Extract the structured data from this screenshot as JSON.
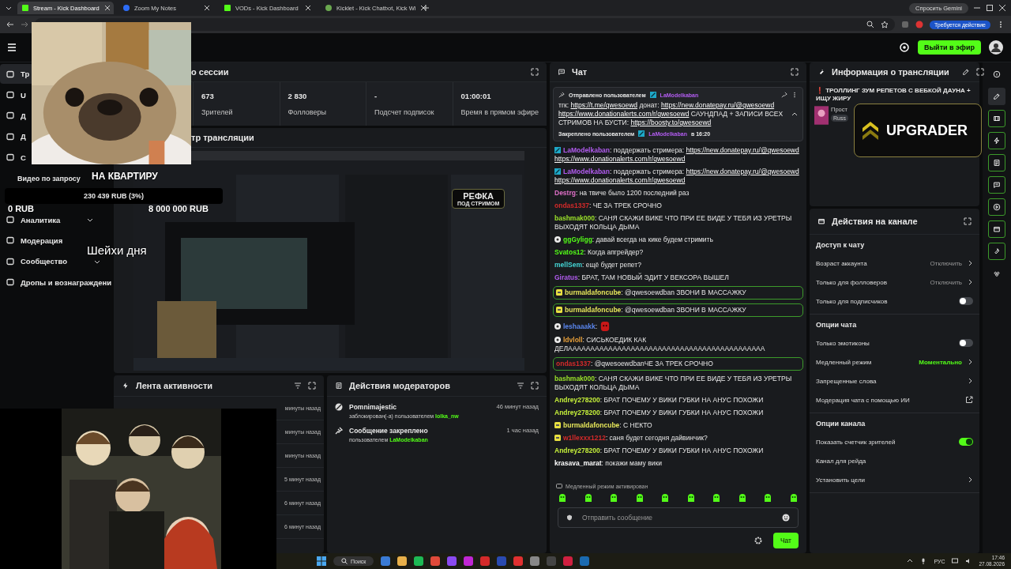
{
  "browser": {
    "tabs": [
      {
        "title": "Stream - Kick Dashboard",
        "kind": "kick",
        "selected": true
      },
      {
        "title": "Zoom My Notes",
        "kind": "zoom",
        "selected": false
      },
      {
        "title": "VODs - Kick Dashboard",
        "kind": "kick",
        "selected": false
      },
      {
        "title": "Kicklet - Kick Chatbot, Kick Wi",
        "kind": "kicklet",
        "selected": false
      }
    ],
    "gemini": "Спросить Gemini",
    "action_required": "Требуется действие"
  },
  "header": {
    "go_live": "Выйти в эфир"
  },
  "sidebar": {
    "items": [
      {
        "label": "Тр",
        "selected": true,
        "expandable": false
      },
      {
        "label": "U",
        "selected": false,
        "expandable": false
      },
      {
        "label": "Д",
        "selected": false,
        "expandable": false
      },
      {
        "label": "Д",
        "selected": false,
        "expandable": false
      },
      {
        "label": "С",
        "selected": false,
        "expandable": false
      },
      {
        "label": "Видео по запросу",
        "selected": false,
        "expandable": false
      },
      {
        "label": "Аналитика",
        "selected": false,
        "expandable": true
      },
      {
        "label": "Модерация",
        "selected": false,
        "expandable": false
      },
      {
        "label": "Сообщество",
        "selected": false,
        "expandable": true
      },
      {
        "label": "Дропы и вознаграждени",
        "selected": false,
        "expandable": false
      }
    ]
  },
  "session": {
    "title": "о сессии",
    "stats": [
      {
        "value": "673",
        "label": "Зрителей"
      },
      {
        "value": "2 830",
        "label": "Фолловеры"
      },
      {
        "value": "-",
        "label": "Подсчет подписок"
      },
      {
        "value": "01:00:01",
        "label": "Время в прямом эфире"
      }
    ]
  },
  "preview": {
    "title": "тр трансляции",
    "overlay_line_1": "РЕФКА",
    "overlay_line_2": "ПОД СТРИМОМ"
  },
  "stream_overlay": {
    "goal_title": "НА КВАРТИРУ",
    "goal_progress": "230 439 RUB (3%)",
    "goal_start": "0 RUB",
    "goal_end": "8 000 000 RUB",
    "caption": "Шейхи дня"
  },
  "activity": {
    "title": "Лента активности",
    "times": [
      "минуты назад",
      "минуты назад",
      "минуты назад",
      "5 минут назад",
      "6 минут назад",
      "6 минут назад"
    ]
  },
  "mod_actions": {
    "title": "Действия модераторов",
    "items": [
      {
        "kind": "ban",
        "title": "Pomnimajestic",
        "text": "заблокирован(-а) пользователем",
        "user": "lolka_nw",
        "time": "46 минут назад"
      },
      {
        "kind": "pin",
        "title": "Сообщение закреплено",
        "text": "пользователем",
        "user": "LaModelkaban",
        "time": "1 час назад"
      }
    ]
  },
  "chat": {
    "title": "Чат",
    "pinned": {
      "sent_by": "Отправлено пользователем",
      "user": "LaModelkaban",
      "parts": [
        {
          "text": "тгк:"
        },
        {
          "text": "https://t.me/qwesoewd",
          "link": true
        },
        {
          "text": "донат:"
        },
        {
          "text": "https://new.donatepay.ru/@qwesoewd",
          "link": true
        },
        {
          "text": "https://www.donationalerts.com/r/qwesoewd",
          "link": true
        },
        {
          "text": "САУНДПАД + ЗАПИСИ ВСЕХ СТРИМОВ НА БУСТИ:"
        },
        {
          "text": "https://boosty.to/qwesoewd",
          "link": true
        }
      ],
      "pinned_by": "Закреплено пользователем",
      "pinned_user": "LaModelkaban",
      "pinned_time": "в 16:20"
    },
    "messages": [
      {
        "user": "LaModelkaban",
        "color": "#b25cf0",
        "kind": "mod",
        "highlighted": false,
        "parts": [
          {
            "text": ": поддержать стримера:"
          },
          {
            "text": "https://new.donatepay.ru/@qwesoewd",
            "link": true
          },
          {
            "text": "https://www.donationalerts.com/r/qwesoewd",
            "link": true
          }
        ]
      },
      {
        "user": "LaModelkaban",
        "color": "#b25cf0",
        "kind": "mod",
        "highlighted": false,
        "parts": [
          {
            "text": ": поддержать стримера:"
          },
          {
            "text": "https://new.donatepay.ru/@qwesoewd",
            "link": true
          },
          {
            "text": "https://www.donationalerts.com/r/qwesoewd",
            "link": true
          }
        ]
      },
      {
        "user": "Destrg",
        "color": "#e070c8",
        "kind": "plain",
        "highlighted": false,
        "parts": [
          {
            "text": ": на твиче было 1200 последний раз"
          }
        ]
      },
      {
        "user": "ondas1337",
        "color": "#d42a2a",
        "kind": "plain",
        "highlighted": false,
        "parts": [
          {
            "text": ": ЧЕ ЗА ТРЕК СРОЧНО"
          }
        ]
      },
      {
        "user": "bashmak000",
        "color": "#9be22a",
        "kind": "plain",
        "highlighted": false,
        "parts": [
          {
            "text": ": САНЯ СКАЖИ ВИКЕ ЧТО ПРИ ЕЕ ВИДЕ У ТЕБЯ ИЗ УРЕТРЫ ВЫХОДЯТ КОЛЬЦА ДЫМА"
          }
        ]
      },
      {
        "user": "ggGyligg",
        "color": "#53fc18",
        "kind": "circle",
        "highlighted": false,
        "parts": [
          {
            "text": ": давай всегда на кике будем стримить"
          }
        ]
      },
      {
        "user": "Svatos12",
        "color": "#53fc18",
        "kind": "plain",
        "highlighted": false,
        "parts": [
          {
            "text": ": Когда апгрейдер?"
          }
        ]
      },
      {
        "user": "mellSem",
        "color": "#44d4d4",
        "kind": "plain",
        "highlighted": false,
        "parts": [
          {
            "text": ": ещё будет репет?"
          }
        ]
      },
      {
        "user": "Giratus",
        "color": "#b25cf0",
        "kind": "plain",
        "highlighted": false,
        "parts": [
          {
            "text": ": БРАТ, ТАМ НОВЫЙ ЭДИТ У ВЕКСОРА ВЫШЕЛ"
          }
        ]
      },
      {
        "user": "burmaldafoncube",
        "color": "#e6e65a",
        "kind": "sub",
        "highlighted": true,
        "parts": [
          {
            "text": ": @qwesoewdban ЗВОНИ В МАССАЖКУ"
          }
        ]
      },
      {
        "user": "burmaldafoncube",
        "color": "#e6e65a",
        "kind": "sub",
        "highlighted": true,
        "parts": [
          {
            "text": ": @qwesoewdban ЗВОНИ В МАССАЖКУ"
          }
        ]
      },
      {
        "user": "leshaaakk",
        "color": "#5a86ee",
        "kind": "circle",
        "highlighted": false,
        "emote": true,
        "parts": [
          {
            "text": ":"
          }
        ]
      },
      {
        "user": "ldvloll",
        "color": "#e8a03a",
        "kind": "circle",
        "highlighted": false,
        "parts": [
          {
            "text": ": СИСЬКОЕДИК КАК ДЕЛАААААААААААААААААААААААААААААААААААААААААААА"
          }
        ]
      },
      {
        "user": "ondas1337",
        "color": "#d42a2a",
        "kind": "plain",
        "highlighted": true,
        "parts": [
          {
            "text": ": @qwesoewdbanЧЕ ЗА ТРЕК СРОЧНО"
          }
        ]
      },
      {
        "user": "bashmak000",
        "color": "#9be22a",
        "kind": "plain",
        "highlighted": false,
        "parts": [
          {
            "text": ": САНЯ СКАЖИ ВИКЕ ЧТО ПРИ ЕЕ ВИДЕ У ТЕБЯ ИЗ УРЕТРЫ ВЫХОДЯТ КОЛЬЦА ДЫМА"
          }
        ]
      },
      {
        "user": "Andrey278200",
        "color": "#c4ee3a",
        "kind": "plain",
        "highlighted": false,
        "parts": [
          {
            "text": ": БРАТ ПОЧЕМУ У ВИКИ ГУБКИ НА АНУС ПОХОЖИ"
          }
        ]
      },
      {
        "user": "Andrey278200",
        "color": "#c4ee3a",
        "kind": "plain",
        "highlighted": false,
        "parts": [
          {
            "text": ": БРАТ ПОЧЕМУ У ВИКИ ГУБКИ НА АНУС ПОХОЖИ"
          }
        ]
      },
      {
        "user": "burmaldafoncube",
        "color": "#e6e65a",
        "kind": "sub",
        "highlighted": false,
        "parts": [
          {
            "text": ": С НЕКТО"
          }
        ]
      },
      {
        "user": "w1llexxx1212",
        "color": "#d42a2a",
        "kind": "sub",
        "highlighted": false,
        "parts": [
          {
            "text": ": саня будет сегодня дайвинчик?"
          }
        ]
      },
      {
        "user": "Andrey278200",
        "color": "#c4ee3a",
        "kind": "plain",
        "highlighted": false,
        "parts": [
          {
            "text": ": БРАТ ПОЧЕМУ У ВИКИ ГУБКИ НА АНУС ПОХОЖИ"
          }
        ]
      },
      {
        "user": "krasava_marat",
        "color": "#ffffff",
        "kind": "plain",
        "highlighted": false,
        "parts": [
          {
            "text": ": покажи маму вики"
          }
        ]
      }
    ],
    "slow_mode": "Медленный режим активирован",
    "placeholder": "Отправить сообщение",
    "send": "Чат"
  },
  "stream_info": {
    "title": "Информация о трансляции",
    "stream_title": "❗ ТРОЛЛИНГ ЗУМ РЕПЕТОВ С ВЕБКОЙ ДАУНА + ИЩУ ЖИРУ",
    "category": "Прост",
    "tag": "Russ",
    "overlay_brand": "UPGRADER"
  },
  "channel_actions": {
    "title": "Действия на канале",
    "sections": [
      {
        "heading": "Доступ к чату",
        "rows": [
          {
            "label": "Возраст аккаунта",
            "kind": "value",
            "value": "Отключить",
            "accent": false
          },
          {
            "label": "Только для фолловеров",
            "kind": "value",
            "value": "Отключить",
            "accent": false
          },
          {
            "label": "Только для подписчиков",
            "kind": "toggle",
            "on": false
          }
        ]
      },
      {
        "heading": "Опции чата",
        "rows": [
          {
            "label": "Только эмотиконы",
            "kind": "toggle",
            "on": false
          },
          {
            "label": "Медленный режим",
            "kind": "value",
            "value": "Моментально",
            "accent": true
          },
          {
            "label": "Запрещенные слова",
            "kind": "chevron"
          },
          {
            "label": "Модерация чата с помощью ИИ",
            "kind": "external"
          }
        ]
      },
      {
        "heading": "Опции канала",
        "rows": [
          {
            "label": "Показать счетчик зрителей",
            "kind": "toggle",
            "on": true
          },
          {
            "label": "Канал для рейда",
            "kind": "plain"
          },
          {
            "label": "Установить цели",
            "kind": "chevron"
          }
        ]
      }
    ]
  },
  "rail": {
    "icons": [
      {
        "kind": "info",
        "selected": false,
        "pinned": false
      },
      {
        "kind": "edit",
        "selected": true,
        "pinned": false
      },
      {
        "kind": "video",
        "selected": false,
        "pinned": true
      },
      {
        "kind": "bolt",
        "selected": false,
        "pinned": true
      },
      {
        "kind": "list",
        "selected": false,
        "pinned": true
      },
      {
        "kind": "chat",
        "selected": false,
        "pinned": true
      },
      {
        "kind": "play",
        "selected": false,
        "pinned": true
      },
      {
        "kind": "card",
        "selected": false,
        "pinned": true
      },
      {
        "kind": "wrench",
        "selected": false,
        "pinned": true
      },
      {
        "kind": "group",
        "selected": false,
        "pinned": false
      }
    ]
  },
  "taskbar": {
    "search": "Поиск",
    "language": "РУС",
    "time": "17:46",
    "date": "27.08.2026"
  }
}
